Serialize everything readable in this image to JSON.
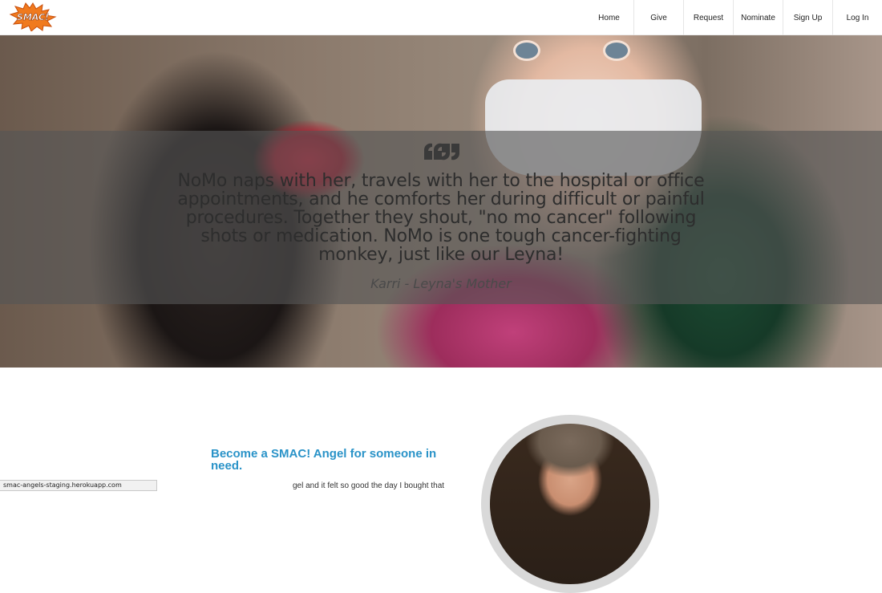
{
  "brand": {
    "logo_text": "SMAC!"
  },
  "nav": {
    "items": [
      {
        "label": "Home"
      },
      {
        "label": "Give"
      },
      {
        "label": "Request"
      },
      {
        "label": "Nominate"
      },
      {
        "label": "Sign Up"
      },
      {
        "label": "Log In"
      }
    ]
  },
  "hero": {
    "quote": "NoMo naps with her, travels with her to the hospital or office appointments, and he comforts her during difficult or painful procedures. Together they shout, \"no mo cancer\" following shots or medication. NoMo is one tough cancer-fighting monkey, just like our Leyna!",
    "author": "Karri - Leyna's Mother"
  },
  "cta": {
    "heading": "Become a SMAC! Angel for someone in need.",
    "body_snippet": "gel and it felt so good the day I bought that"
  },
  "status_bar": {
    "url": "smac-angels-staging.herokuapp.com"
  },
  "colors": {
    "accent": "#2a93c8",
    "logo_orange": "#f07a1e",
    "band": "#555555"
  }
}
